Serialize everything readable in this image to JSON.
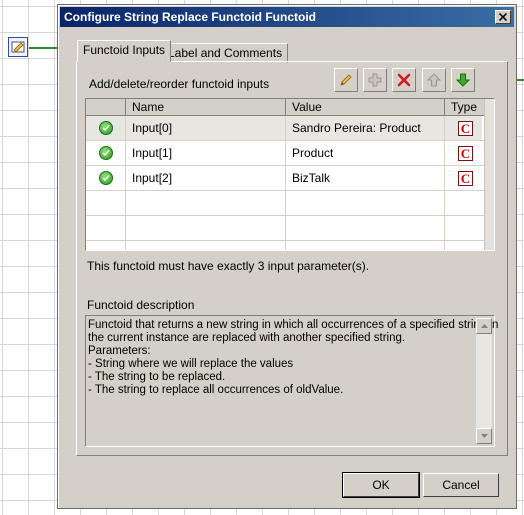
{
  "dialog": {
    "title": "Configure String Replace Functoid Functoid"
  },
  "tabs": [
    {
      "label": "Functoid Inputs",
      "active": true
    },
    {
      "label": "Label and Comments",
      "active": false
    }
  ],
  "inputs": {
    "toolbar_label": "Add/delete/reorder functoid inputs",
    "toolbar_icons": [
      "pencil-icon",
      "add-plus-icon",
      "delete-x-icon",
      "move-up-arrow-icon",
      "move-down-arrow-icon"
    ],
    "columns": {
      "name": "Name",
      "value": "Value",
      "type": "Type"
    },
    "rows": [
      {
        "name": "Input[0]",
        "value": "Sandro Pereira: Product",
        "type": "C"
      },
      {
        "name": "Input[1]",
        "value": "Product",
        "type": "C"
      },
      {
        "name": "Input[2]",
        "value": "BizTalk",
        "type": "C"
      }
    ],
    "constraint": "This functoid must have exactly 3 input parameter(s)."
  },
  "description": {
    "label": "Functoid description",
    "lines": [
      "Functoid that returns a new string in which all occurrences of a specified string in",
      "the current instance are replaced with another specified string.",
      "Parameters:",
      "- String where we will replace the values",
      "- The string to be replaced.",
      "- The string to replace all occurrences of oldValue."
    ]
  },
  "buttons": {
    "ok": "OK",
    "cancel": "Cancel"
  },
  "colors": {
    "titlebar": "#0a246a",
    "dialog_bg": "#d4d0c8",
    "status_ok": "#2c9a1f",
    "type_icon": "#cc0000"
  }
}
